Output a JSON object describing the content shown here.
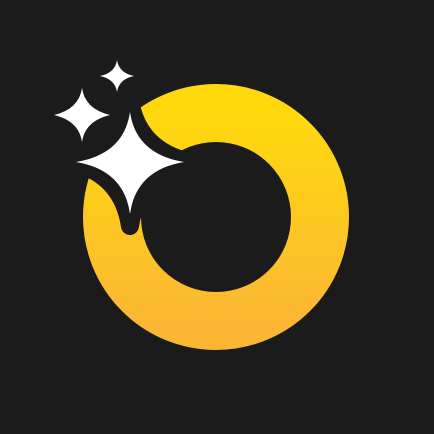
{
  "icon": {
    "background_color": "#1b1b1c",
    "ring_gradient_top": "#ffd90d",
    "ring_gradient_bottom": "#fbb733",
    "sparkle_color": "#ffffff",
    "ring_icon": "ring-icon",
    "large_sparkle_icon": "large-sparkle-icon",
    "medium_sparkle_icon": "medium-sparkle-icon",
    "small_sparkle_icon": "small-sparkle-icon"
  }
}
